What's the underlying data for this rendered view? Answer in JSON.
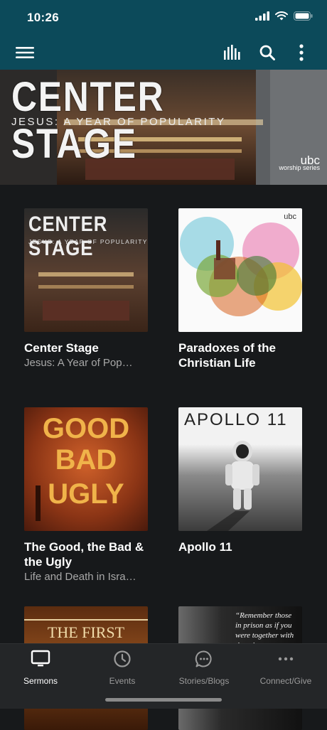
{
  "status_bar": {
    "time": "10:26"
  },
  "hero": {
    "title": "CENTER STAGE",
    "subtitle": "JESUS: A YEAR OF POPULARITY",
    "badge_name": "ubc",
    "badge_sub": "worship series"
  },
  "cards": [
    {
      "title": "Center Stage",
      "subtitle": "Jesus: A Year of Pop…",
      "art_line1": "CENTER STAGE",
      "art_line2": "JESUS: A YEAR OF POPULARITY"
    },
    {
      "title": "Paradoxes of the Christian Life",
      "subtitle": "",
      "art_badge": "ubc"
    },
    {
      "title": "The Good, the Bad & the Ugly",
      "subtitle": "Life and Death in Isra…",
      "art_line1": "GOOD",
      "art_line2": "BAD",
      "art_line3": "UGLY"
    },
    {
      "title": "Apollo 11",
      "subtitle": "",
      "art_line1": "APOLLO 11"
    },
    {
      "title": "",
      "subtitle": "",
      "art_line1": "THE FIRST"
    },
    {
      "title": "",
      "subtitle": "",
      "art_line1": "“Remember those in prison as if you were together with them in"
    }
  ],
  "tabs": [
    {
      "label": "Sermons",
      "icon": "tv-icon",
      "active": true
    },
    {
      "label": "Events",
      "icon": "clock-icon",
      "active": false
    },
    {
      "label": "Stories/Blogs",
      "icon": "chat-bubble-icon",
      "active": false
    },
    {
      "label": "Connect/Give",
      "icon": "more-dots-icon",
      "active": false
    }
  ],
  "colors": {
    "header": "#0c4a5a",
    "background": "#17191b",
    "tabbar": "#242628"
  }
}
